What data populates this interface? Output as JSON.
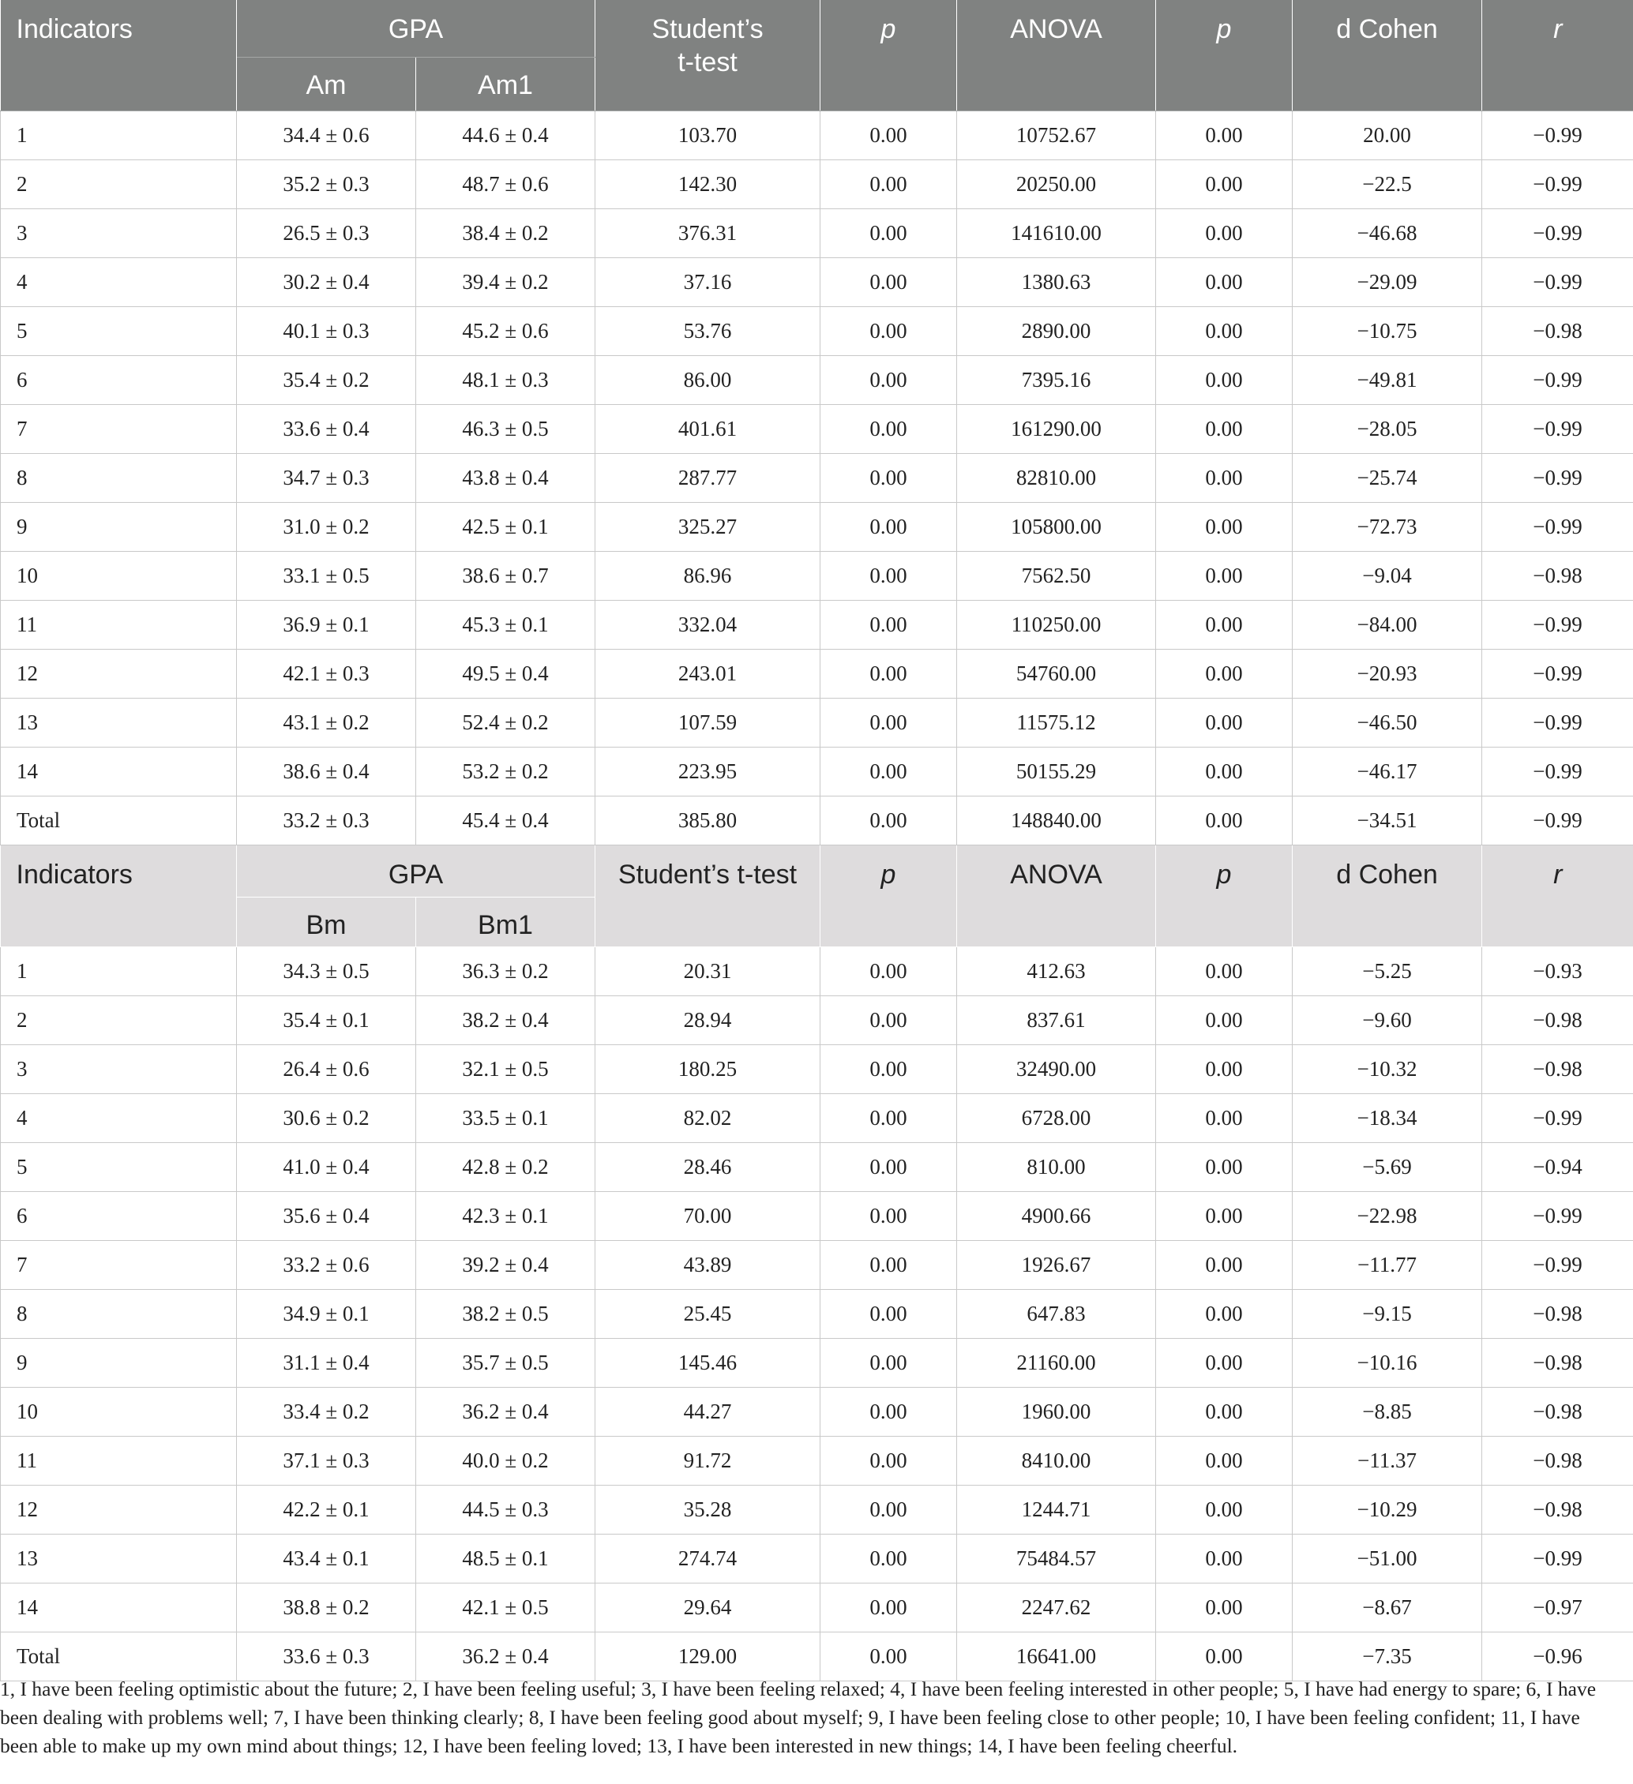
{
  "columns": {
    "indicators": "Indicators",
    "gpa": "GPA",
    "ttest_a": [
      "Student’s",
      "t-test"
    ],
    "ttest_b": "Student’s t-test",
    "p": "p",
    "anova": "ANOVA",
    "p2": "p",
    "dcohen": "d Cohen",
    "r": "r"
  },
  "sectionA": {
    "sub1": "Am",
    "sub2": "Am1",
    "rows": [
      [
        "1",
        "34.4 ± 0.6",
        "44.6 ± 0.4",
        "103.70",
        "0.00",
        "10752.67",
        "0.00",
        "20.00",
        "−0.99"
      ],
      [
        "2",
        "35.2 ± 0.3",
        "48.7 ± 0.6",
        "142.30",
        "0.00",
        "20250.00",
        "0.00",
        "−22.5",
        "−0.99"
      ],
      [
        "3",
        "26.5 ± 0.3",
        "38.4 ± 0.2",
        "376.31",
        "0.00",
        "141610.00",
        "0.00",
        "−46.68",
        "−0.99"
      ],
      [
        "4",
        "30.2 ± 0.4",
        "39.4 ± 0.2",
        "37.16",
        "0.00",
        "1380.63",
        "0.00",
        "−29.09",
        "−0.99"
      ],
      [
        "5",
        "40.1 ± 0.3",
        "45.2 ± 0.6",
        "53.76",
        "0.00",
        "2890.00",
        "0.00",
        "−10.75",
        "−0.98"
      ],
      [
        "6",
        "35.4 ± 0.2",
        "48.1 ± 0.3",
        "86.00",
        "0.00",
        "7395.16",
        "0.00",
        "−49.81",
        "−0.99"
      ],
      [
        "7",
        "33.6 ± 0.4",
        "46.3 ± 0.5",
        "401.61",
        "0.00",
        "161290.00",
        "0.00",
        "−28.05",
        "−0.99"
      ],
      [
        "8",
        "34.7 ± 0.3",
        "43.8 ± 0.4",
        "287.77",
        "0.00",
        "82810.00",
        "0.00",
        "−25.74",
        "−0.99"
      ],
      [
        "9",
        "31.0 ± 0.2",
        "42.5 ± 0.1",
        "325.27",
        "0.00",
        "105800.00",
        "0.00",
        "−72.73",
        "−0.99"
      ],
      [
        "10",
        "33.1 ± 0.5",
        "38.6 ± 0.7",
        "86.96",
        "0.00",
        "7562.50",
        "0.00",
        "−9.04",
        "−0.98"
      ],
      [
        "11",
        "36.9 ± 0.1",
        "45.3 ± 0.1",
        "332.04",
        "0.00",
        "110250.00",
        "0.00",
        "−84.00",
        "−0.99"
      ],
      [
        "12",
        "42.1 ± 0.3",
        "49.5 ± 0.4",
        "243.01",
        "0.00",
        "54760.00",
        "0.00",
        "−20.93",
        "−0.99"
      ],
      [
        "13",
        "43.1 ± 0.2",
        "52.4 ± 0.2",
        "107.59",
        "0.00",
        "11575.12",
        "0.00",
        "−46.50",
        "−0.99"
      ],
      [
        "14",
        "38.6 ± 0.4",
        "53.2 ± 0.2",
        "223.95",
        "0.00",
        "50155.29",
        "0.00",
        "−46.17",
        "−0.99"
      ],
      [
        "Total",
        "33.2 ± 0.3",
        "45.4 ± 0.4",
        "385.80",
        "0.00",
        "148840.00",
        "0.00",
        "−34.51",
        "−0.99"
      ]
    ]
  },
  "sectionB": {
    "sub1": "Bm",
    "sub2": "Bm1",
    "rows": [
      [
        "1",
        "34.3 ± 0.5",
        "36.3 ± 0.2",
        "20.31",
        "0.00",
        "412.63",
        "0.00",
        "−5.25",
        "−0.93"
      ],
      [
        "2",
        "35.4 ± 0.1",
        "38.2 ± 0.4",
        "28.94",
        "0.00",
        "837.61",
        "0.00",
        "−9.60",
        "−0.98"
      ],
      [
        "3",
        "26.4 ± 0.6",
        "32.1 ± 0.5",
        "180.25",
        "0.00",
        "32490.00",
        "0.00",
        "−10.32",
        "−0.98"
      ],
      [
        "4",
        "30.6 ± 0.2",
        "33.5 ± 0.1",
        "82.02",
        "0.00",
        "6728.00",
        "0.00",
        "−18.34",
        "−0.99"
      ],
      [
        "5",
        "41.0 ± 0.4",
        "42.8 ± 0.2",
        "28.46",
        "0.00",
        "810.00",
        "0.00",
        "−5.69",
        "−0.94"
      ],
      [
        "6",
        "35.6 ± 0.4",
        "42.3 ± 0.1",
        "70.00",
        "0.00",
        "4900.66",
        "0.00",
        "−22.98",
        "−0.99"
      ],
      [
        "7",
        "33.2 ± 0.6",
        "39.2 ± 0.4",
        "43.89",
        "0.00",
        "1926.67",
        "0.00",
        "−11.77",
        "−0.99"
      ],
      [
        "8",
        "34.9 ± 0.1",
        "38.2 ± 0.5",
        "25.45",
        "0.00",
        "647.83",
        "0.00",
        "−9.15",
        "−0.98"
      ],
      [
        "9",
        "31.1 ± 0.4",
        "35.7 ± 0.5",
        "145.46",
        "0.00",
        "21160.00",
        "0.00",
        "−10.16",
        "−0.98"
      ],
      [
        "10",
        "33.4 ± 0.2",
        "36.2 ± 0.4",
        "44.27",
        "0.00",
        "1960.00",
        "0.00",
        "−8.85",
        "−0.98"
      ],
      [
        "11",
        "37.1 ± 0.3",
        "40.0 ± 0.2",
        "91.72",
        "0.00",
        "8410.00",
        "0.00",
        "−11.37",
        "−0.98"
      ],
      [
        "12",
        "42.2 ± 0.1",
        "44.5 ± 0.3",
        "35.28",
        "0.00",
        "1244.71",
        "0.00",
        "−10.29",
        "−0.98"
      ],
      [
        "13",
        "43.4 ± 0.1",
        "48.5 ± 0.1",
        "274.74",
        "0.00",
        "75484.57",
        "0.00",
        "−51.00",
        "−0.99"
      ],
      [
        "14",
        "38.8 ± 0.2",
        "42.1 ± 0.5",
        "29.64",
        "0.00",
        "2247.62",
        "0.00",
        "−8.67",
        "−0.97"
      ],
      [
        "Total",
        "33.6 ± 0.3",
        "36.2 ± 0.4",
        "129.00",
        "0.00",
        "16641.00",
        "0.00",
        "−7.35",
        "−0.96"
      ]
    ]
  },
  "footnote": "1, I have been feeling optimistic about the future; 2, I have been feeling useful; 3, I have been feeling relaxed; 4, I have been feeling interested in other people; 5, I have had energy to spare; 6, I have been dealing with problems well; 7, I have been thinking clearly; 8, I have been feeling good about myself; 9, I have been feeling close to other people; 10, I have been feeling confident; 11, I have been able to make up my own mind about things; 12, I have been feeling loved; 13, I have been interested in new things; 14, I have been feeling cheerful."
}
